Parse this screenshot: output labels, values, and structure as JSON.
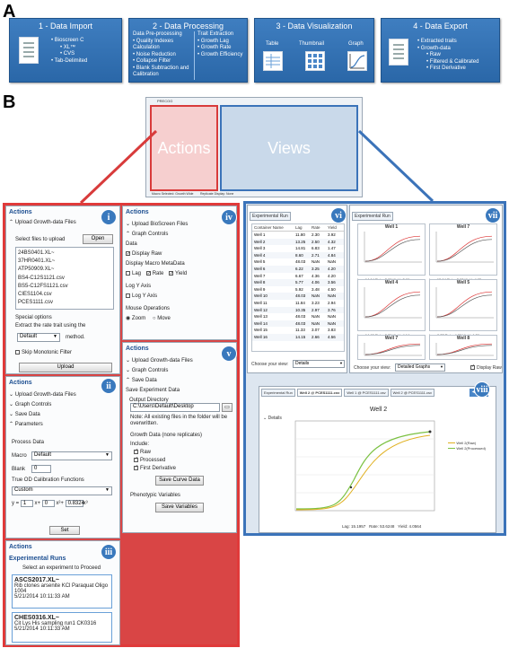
{
  "panel_labels": {
    "a": "A",
    "b": "B"
  },
  "steps": [
    {
      "title": "1 - Data Import",
      "items": [
        "Bioscreen C",
        "XL™",
        "CVS",
        "Tab-Delimited"
      ]
    },
    {
      "title": "2 - Data Processing",
      "preprocessing_title": "Data Pre-processing",
      "preprocessing_items": [
        "Quality Indexes Calculation",
        "Noise Reduction",
        "Collapse Filter",
        "Blank Subtraction and Calibration"
      ],
      "trait_title": "Trait Extraction",
      "trait_items": [
        "Growth Lag",
        "Growth Rate",
        "Growth Efficiency"
      ]
    },
    {
      "title": "3 - Data Visualization",
      "icons": [
        "Table",
        "Thumbnail",
        "Graph"
      ]
    },
    {
      "title": "4 - Data Export",
      "items": [
        "Extracted traits",
        "Growth-data",
        "Raw",
        "Filtered & Calibrated",
        "First Derivative"
      ]
    }
  ],
  "overview": {
    "actions_label": "Actions",
    "views_label": "Views",
    "window_title": "PRECOG",
    "status_left": "Macro Selected: Growth Wide",
    "status_right": "Replicate Display: None"
  },
  "roman": [
    "i",
    "ii",
    "iii",
    "iv",
    "v",
    "vi",
    "vii",
    "viii"
  ],
  "panel_i": {
    "header": "Actions",
    "upload_label": "Upload Growth-data Files",
    "select_label": "Select files to upload",
    "open_btn": "Open",
    "files": [
      "24BS0401.XL~",
      "37HR0401.XL~",
      "ATP50909.XL~",
      "BS4-C12S1121.csv",
      "BS5-C12FS1121.csv",
      "CIES1104.csv",
      "PCES1111.csv"
    ],
    "special": "Special options",
    "extract": "Extract the rate trait using the",
    "method_value": "Default",
    "method_suffix": "method.",
    "skip": "Skip Monotonic Filter",
    "upload_btn": "Upload"
  },
  "panel_ii": {
    "header": "Actions",
    "items": [
      "Upload Growth-data Files",
      "Graph Controls",
      "Save Data",
      "Parameters"
    ],
    "process": "Process Data",
    "macro_label": "Macro",
    "macro_value": "Default",
    "blank_label": "Blank",
    "blank_value": "0",
    "true_od": "True OD Calibration Functions",
    "custom": "Custom",
    "eq_y": "y =",
    "eq_1": "1",
    "eq_x": "x+",
    "eq_0": "0",
    "eq_x2": "x²+",
    "eq_coef": "0.8324",
    "eq_x3": "x³",
    "set_btn": "Set"
  },
  "panel_iii": {
    "header": "Actions",
    "sub": "Experimental Runs",
    "prompt": "Select an experiment to Proceed",
    "runs": [
      {
        "name": "ASCS2017.XL~",
        "desc": "Rib clones arsenite KCl Paraquat Oligo 1004",
        "date": "5/21/2014 10:11:33 AM"
      },
      {
        "name": "CHES0316.XL~",
        "desc": "Cit Lys His sampling run1 CK0316",
        "date": "5/21/2014 10:11:33 AM"
      }
    ]
  },
  "panel_iv": {
    "header": "Actions",
    "upload": "Upload BioScreen Files",
    "graph": "Graph Controls",
    "data": "Data",
    "display_raw": "Display Raw",
    "macro_meta": "Display Macro MetaData",
    "lag": "Lag",
    "rate": "Rate",
    "yield": "Yield",
    "logy": "Log Y Axis",
    "logy2": "Log Y Axis",
    "mouse": "Mouse Operations",
    "zoom": "Zoom",
    "move": "Move"
  },
  "panel_v": {
    "header": "Actions",
    "items": [
      "Upload Growth-data Files",
      "Graph Controls",
      "Save Data"
    ],
    "save_exp": "Save Experiment Data",
    "output_dir": "Output Directory",
    "path": "C:\\Users\\Default\\Desktop",
    "note": "Note: All existing files in the folder will be overwritten.",
    "growth_data": "Growth Data (none replicates)",
    "include": "Include:",
    "raw": "Raw",
    "processed": "Processed",
    "first_deriv": "First Derivative",
    "save_curve": "Save Curve Data",
    "pheno": "Phenotypic Variables",
    "save_vars": "Save Variables"
  },
  "panel_vi": {
    "tab": "Experimental Run",
    "columns": [
      "Container Name",
      "Lag",
      "Rate",
      "Yield"
    ],
    "rows": [
      [
        "Well 1",
        "11.80",
        "2.30",
        "3.92"
      ],
      [
        "Well 2",
        "13.25",
        "2.50",
        "4.32"
      ],
      [
        "Well 3",
        "14.81",
        "6.83",
        "1.47"
      ],
      [
        "Well 4",
        "8.60",
        "2.71",
        "4.84"
      ],
      [
        "Well 5",
        "48.03",
        "NaN",
        "NaN"
      ],
      [
        "Well 6",
        "6.22",
        "3.25",
        "4.20"
      ],
      [
        "Well 7",
        "6.67",
        "4.36",
        "4.20"
      ],
      [
        "Well 8",
        "5.77",
        "4.06",
        "3.56"
      ],
      [
        "Well 9",
        "5.92",
        "3.48",
        "4.50"
      ],
      [
        "Well 10",
        "48.03",
        "NaN",
        "NaN"
      ],
      [
        "Well 11",
        "11.84",
        "3.23",
        "2.94"
      ],
      [
        "Well 12",
        "10.35",
        "2.97",
        "3.76"
      ],
      [
        "Well 13",
        "48.03",
        "NaN",
        "NaN"
      ],
      [
        "Well 14",
        "48.03",
        "NaN",
        "NaN"
      ],
      [
        "Well 15",
        "11.33",
        "3.07",
        "3.83"
      ],
      [
        "Well 16",
        "14.15",
        "2.66",
        "4.56"
      ]
    ],
    "choose": "Choose your view:",
    "view_value": "Details"
  },
  "panel_vii": {
    "tab": "Experimental Run",
    "wells": [
      {
        "name": "Well 1",
        "stats": "Lag: 14.14   Rate: 3.80   Yield: 2.96"
      },
      {
        "name": "Well 7",
        "stats": "Lag: 15.14   Rate: 3.02   Yield: 4.05"
      },
      {
        "name": "Well 4",
        "stats": "Lag: 14.60   Rate: 3.79   Yield: 4.14"
      },
      {
        "name": "Well 5",
        "stats": "Lag: 8.77   Rate: 4.78   Yield: 4.26"
      },
      {
        "name": "Well 7",
        "stats": ""
      },
      {
        "name": "Well 8",
        "stats": ""
      }
    ],
    "choose": "Choose your view:",
    "view_value": "Detailed Graphs",
    "display_raw": "Display Raw"
  },
  "panel_viii": {
    "tabs": [
      "Experimental Run",
      "Well 2 @ PCES1111.csv",
      "Well 1 @ PCES1111.csv",
      "Well 2 @ PCES1111.csv"
    ],
    "details": "Details",
    "title": "Well 2",
    "legend": [
      "Well 2(Raw)",
      "Well 2(Processed)"
    ],
    "stats_lag_label": "Lag:",
    "stats_lag": "15.1957",
    "stats_rate_label": "Rate:",
    "stats_rate": "53.6248",
    "stats_yield_label": "Yield:",
    "stats_yield": "4.0564"
  },
  "colors": {
    "step_blue": "#2f6fb4",
    "actions_red": "#e03a3a",
    "views_blue": "#3b73b9",
    "raw_curve": "#e0b020",
    "proc_curve": "#7bc142"
  }
}
